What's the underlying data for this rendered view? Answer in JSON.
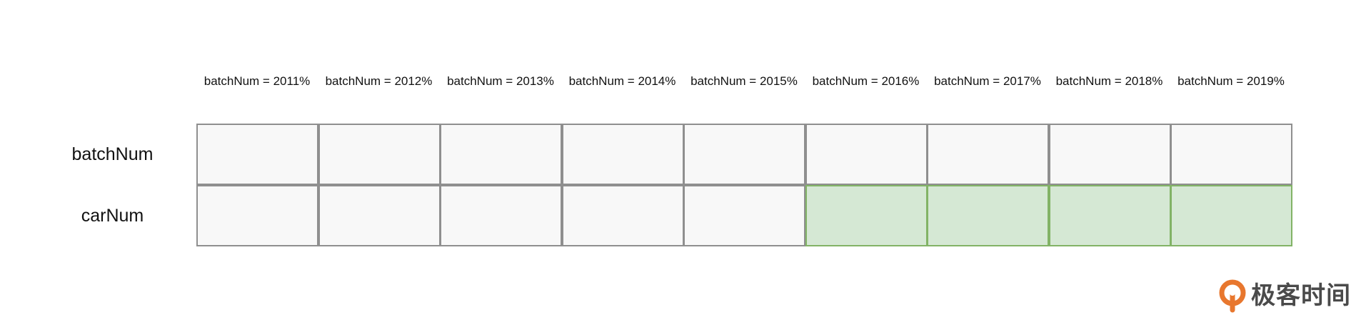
{
  "columns": [
    "batchNum = 2011%",
    "batchNum = 2012%",
    "batchNum = 2013%",
    "batchNum = 2014%",
    "batchNum = 2015%",
    "batchNum = 2016%",
    "batchNum = 2017%",
    "batchNum = 2018%",
    "batchNum = 2019%"
  ],
  "rows": [
    {
      "label": "batchNum",
      "highlighted": [
        false,
        false,
        false,
        false,
        false,
        false,
        false,
        false,
        false
      ]
    },
    {
      "label": "carNum",
      "highlighted": [
        false,
        false,
        false,
        false,
        false,
        true,
        true,
        true,
        true
      ]
    }
  ],
  "colors": {
    "cell_fill": "#f8f8f8",
    "cell_border": "#8f8f8f",
    "highlight_fill": "#d5e8d4",
    "highlight_border": "#82b366",
    "logo_orange": "#e8772e"
  },
  "logo": {
    "text": "极客时间",
    "icon": "geektime-logo-icon"
  }
}
